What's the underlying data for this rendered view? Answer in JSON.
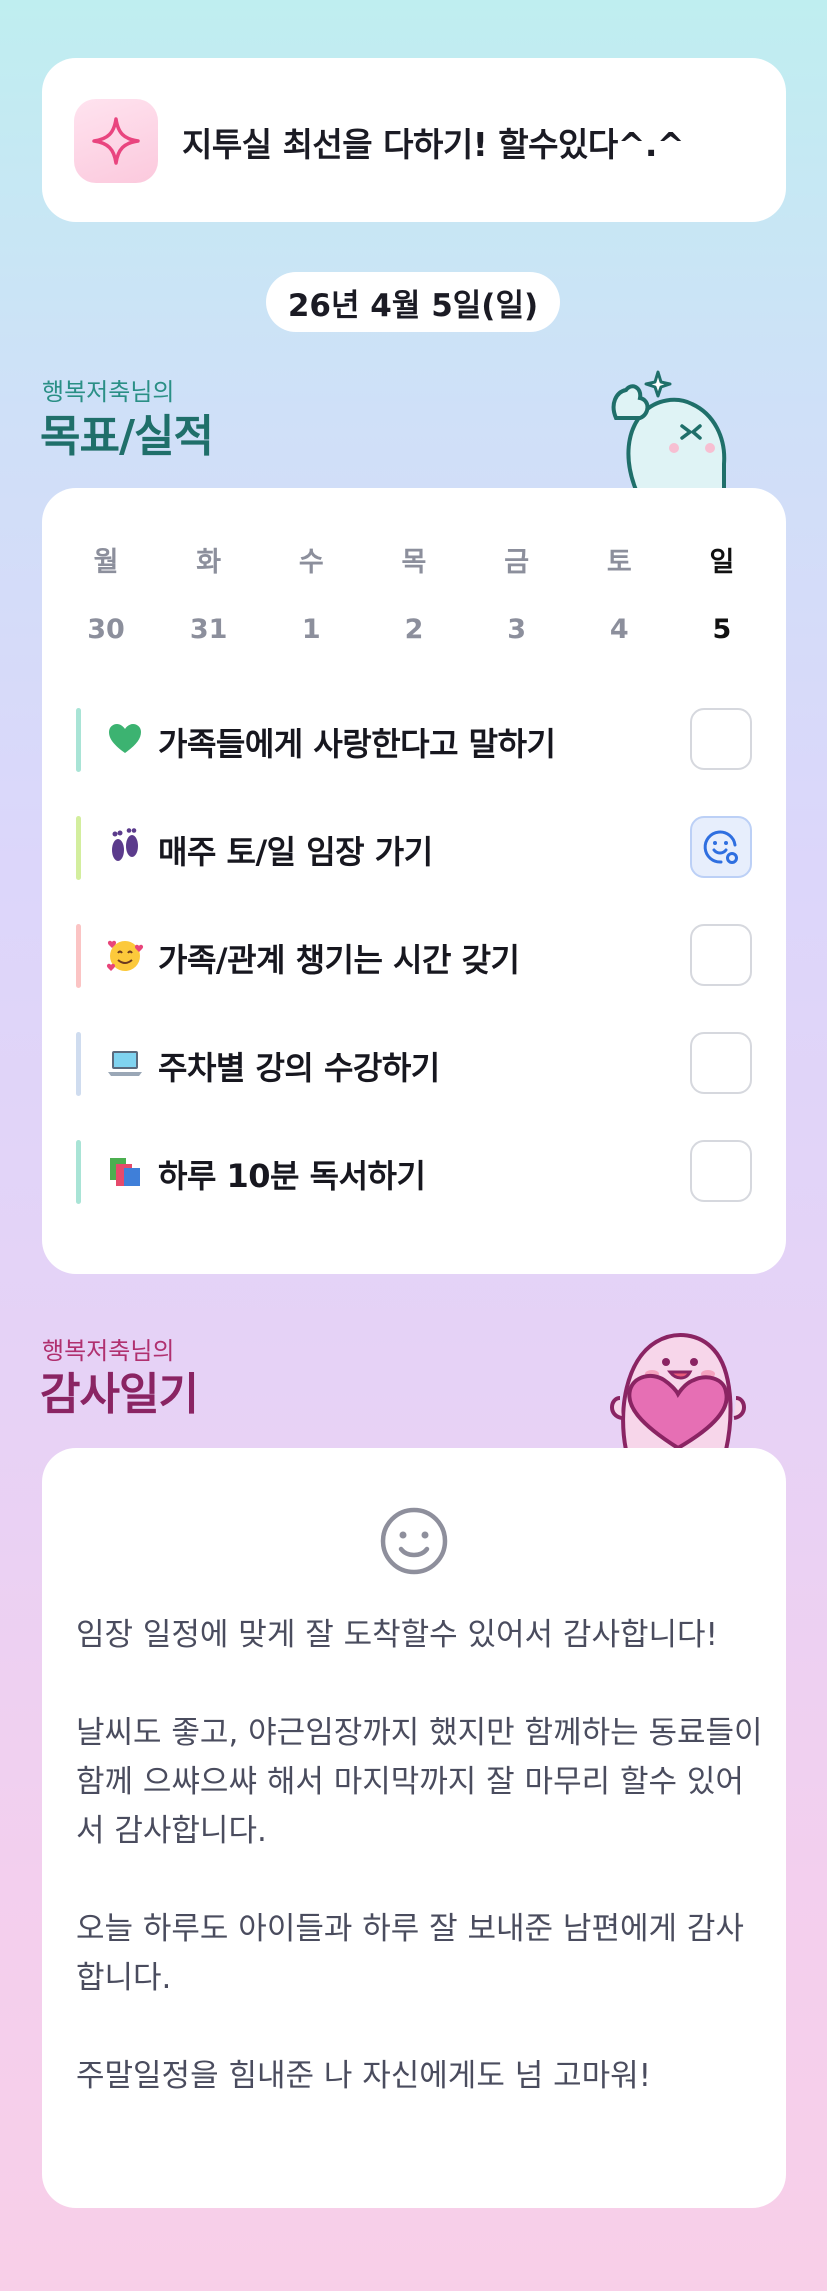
{
  "goal": {
    "icon": "sparkle-icon",
    "text": "지투실 최선을 다하기! 할수있다^.^"
  },
  "date": "26년 4월 5일(일)",
  "tracker_section": {
    "subtitle": "행복저축님의",
    "title": "목표/실적",
    "title_color": "#1f6f6a"
  },
  "week": {
    "days": [
      "월",
      "화",
      "수",
      "목",
      "금",
      "토",
      "일"
    ],
    "dates": [
      "30",
      "31",
      "1",
      "2",
      "3",
      "4",
      "5"
    ],
    "today_index": 6
  },
  "tasks": [
    {
      "emoji": "green-heart-icon",
      "label": "가족들에게 사랑한다고 말하기",
      "bar_color": "#a9e4d6",
      "checked": false
    },
    {
      "emoji": "footprints-icon",
      "label": "매주 토/일 임장 가기",
      "bar_color": "#d3ee9e",
      "checked": true
    },
    {
      "emoji": "smiling-face-with-hearts-icon",
      "label": "가족/관계 챙기는 시간 갖기",
      "bar_color": "#fbc4c4",
      "checked": false
    },
    {
      "emoji": "laptop-icon",
      "label": "주차별 강의 수강하기",
      "bar_color": "#cfdcef",
      "checked": false
    },
    {
      "emoji": "books-icon",
      "label": "하루 10분 독서하기",
      "bar_color": "#a9e4d6",
      "checked": false
    }
  ],
  "diary_section": {
    "subtitle": "행복저축님의",
    "title": "감사일기",
    "title_color": "#8a2463"
  },
  "diary": {
    "mood_icon": "smiley-face-icon",
    "lines": [
      "임장 일정에 맞게 잘 도착할수 있어서 감사합니다!",
      "",
      "날씨도 좋고, 야근임장까지 했지만 함께하는 동료들이",
      "함께 으쌰으쌰 해서 마지막까지 잘 마무리 할수 있어서 감사합니다.",
      "",
      "오늘 하루도 아이들과 하루 잘 보내준 남편에게 감사합니다.",
      "",
      "주말일정을 힘내준 나 자신에게도 넘 고마워!"
    ]
  }
}
